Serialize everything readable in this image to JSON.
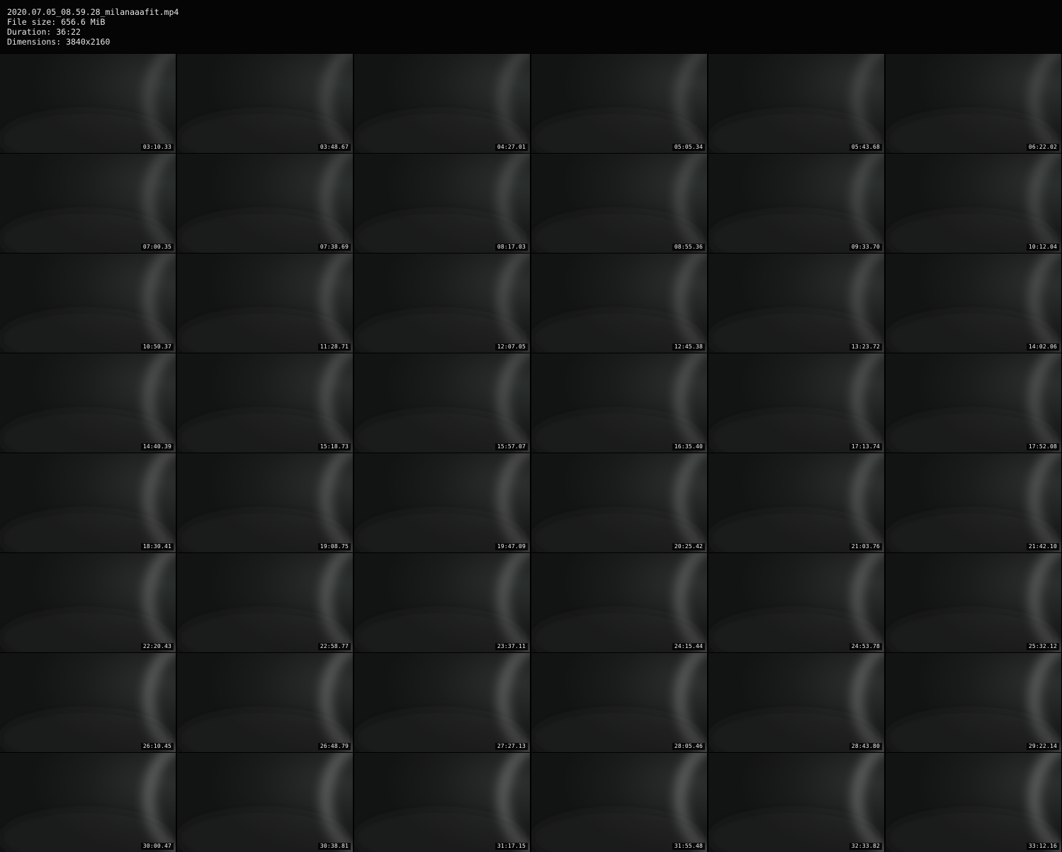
{
  "header": {
    "filename": "2020.07.05_08.59.28_milanaaafit.mp4",
    "file_size": "File size: 656.6 MiB",
    "duration": "Duration: 36:22",
    "dimensions": "Dimensions: 3840x2160"
  },
  "thumbnails": [
    "03:10.33",
    "03:48.67",
    "04:27.01",
    "05:05.34",
    "05:43.68",
    "06:22.02",
    "07:00.35",
    "07:38.69",
    "08:17.03",
    "08:55.36",
    "09:33.70",
    "10:12.04",
    "10:50.37",
    "11:28.71",
    "12:07.05",
    "12:45.38",
    "13:23.72",
    "14:02.06",
    "14:40.39",
    "15:18.73",
    "15:57.07",
    "16:35.40",
    "17:13.74",
    "17:52.08",
    "18:30.41",
    "19:08.75",
    "19:47.09",
    "20:25.42",
    "21:03.76",
    "21:42.10",
    "22:20.43",
    "22:58.77",
    "23:37.11",
    "24:15.44",
    "24:53.78",
    "25:32.12",
    "26:10.45",
    "26:48.79",
    "27:27.13",
    "28:05.46",
    "28:43.80",
    "29:22.14",
    "30:00.47",
    "30:38.81",
    "31:17.15",
    "31:55.48",
    "32:33.82",
    "33:12.16"
  ]
}
